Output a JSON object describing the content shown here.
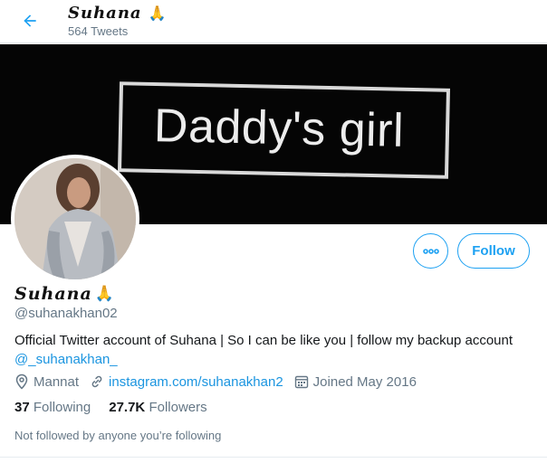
{
  "header": {
    "name": "Suhana",
    "tweet_count": "564 Tweets",
    "back_icon": "arrow-left-icon"
  },
  "banner": {
    "text": "Daddy's girl"
  },
  "profile": {
    "name": "Suhana",
    "handle": "@suhanakhan02",
    "bio_text": "Official Twitter account of Suhana | So I can be like you | follow my backup account",
    "bio_link": "@_suhanakhan_",
    "location": "Mannat",
    "website": "instagram.com/suhanakhan2",
    "joined": "Joined May 2016",
    "following_count": "37",
    "following_label": "Following",
    "followers_count": "27.7K",
    "followers_label": "Followers",
    "not_followed": "Not followed by anyone you’re following"
  },
  "actions": {
    "follow_label": "Follow",
    "more_icon": "more-options-icon"
  },
  "colors": {
    "accent": "#1da1f2",
    "link": "#1b95e0",
    "muted": "#657786"
  }
}
